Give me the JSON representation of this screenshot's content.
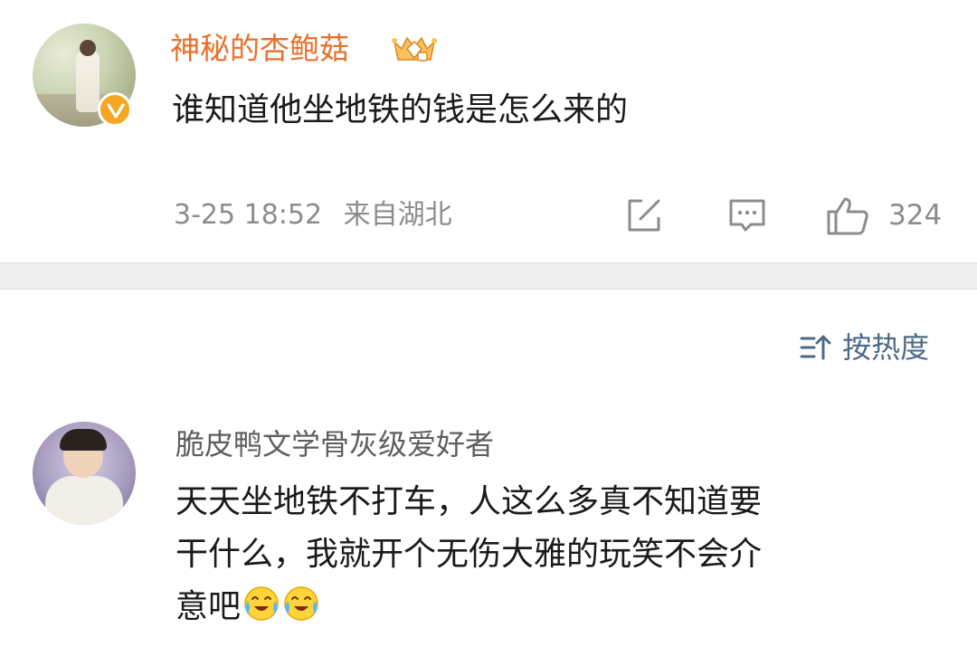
{
  "top_comment": {
    "username": "神秘的杏鲍菇",
    "avatar": "user-avatar-girl-running",
    "verified_badge_icon": "verified-v-icon",
    "member_badge_icon": "member-crown-icon",
    "text": "谁知道他坐地铁的钱是怎么来的",
    "date": "3-25 18:52",
    "location": "来自湖北",
    "share_icon": "share-icon",
    "reply_icon": "comment-icon",
    "like_icon": "thumbs-up-icon",
    "like_count": "324",
    "colors": {
      "username": "#e8712a",
      "badge": "#f5a623"
    }
  },
  "sort": {
    "icon": "sort-icon",
    "label": "按热度"
  },
  "reply_comment": {
    "username": "脆皮鸭文学骨灰级爱好者",
    "avatar": "user-avatar-child",
    "text_lines": [
      "天天坐地铁不打车，人这么多真不知道要",
      "干什么，我就开个无伤大雅的玩笑不会介",
      "意吧"
    ],
    "emojis": [
      "crying-laughing-emoji",
      "crying-laughing-emoji"
    ]
  }
}
